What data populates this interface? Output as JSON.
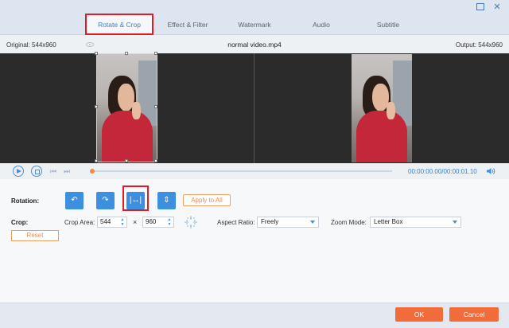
{
  "tabs": [
    {
      "label": "Rotate & Crop",
      "active": true
    },
    {
      "label": "Effect & Filter",
      "active": false
    },
    {
      "label": "Watermark",
      "active": false
    },
    {
      "label": "Audio",
      "active": false
    },
    {
      "label": "Subtitle",
      "active": false
    }
  ],
  "info": {
    "original": "Original: 544x960",
    "filename": "normal video.mp4",
    "output": "Output: 544x960"
  },
  "playback": {
    "time": "00:00:00.00/00:00:01.10",
    "progress": 0
  },
  "rotation": {
    "label": "Rotation:",
    "apply_all": "Apply to All"
  },
  "crop": {
    "label": "Crop:",
    "area_label": "Crop Area:",
    "width": "544",
    "height": "960",
    "times": "×",
    "aspect_label": "Aspect Ratio:",
    "aspect_value": "Freely",
    "zoom_label": "Zoom Mode:",
    "zoom_value": "Letter Box",
    "reset": "Reset"
  },
  "footer": {
    "ok": "OK",
    "cancel": "Cancel"
  },
  "colors": {
    "accent": "#3d8fe0",
    "highlight": "#e01b24",
    "orange": "#f26b3a"
  }
}
